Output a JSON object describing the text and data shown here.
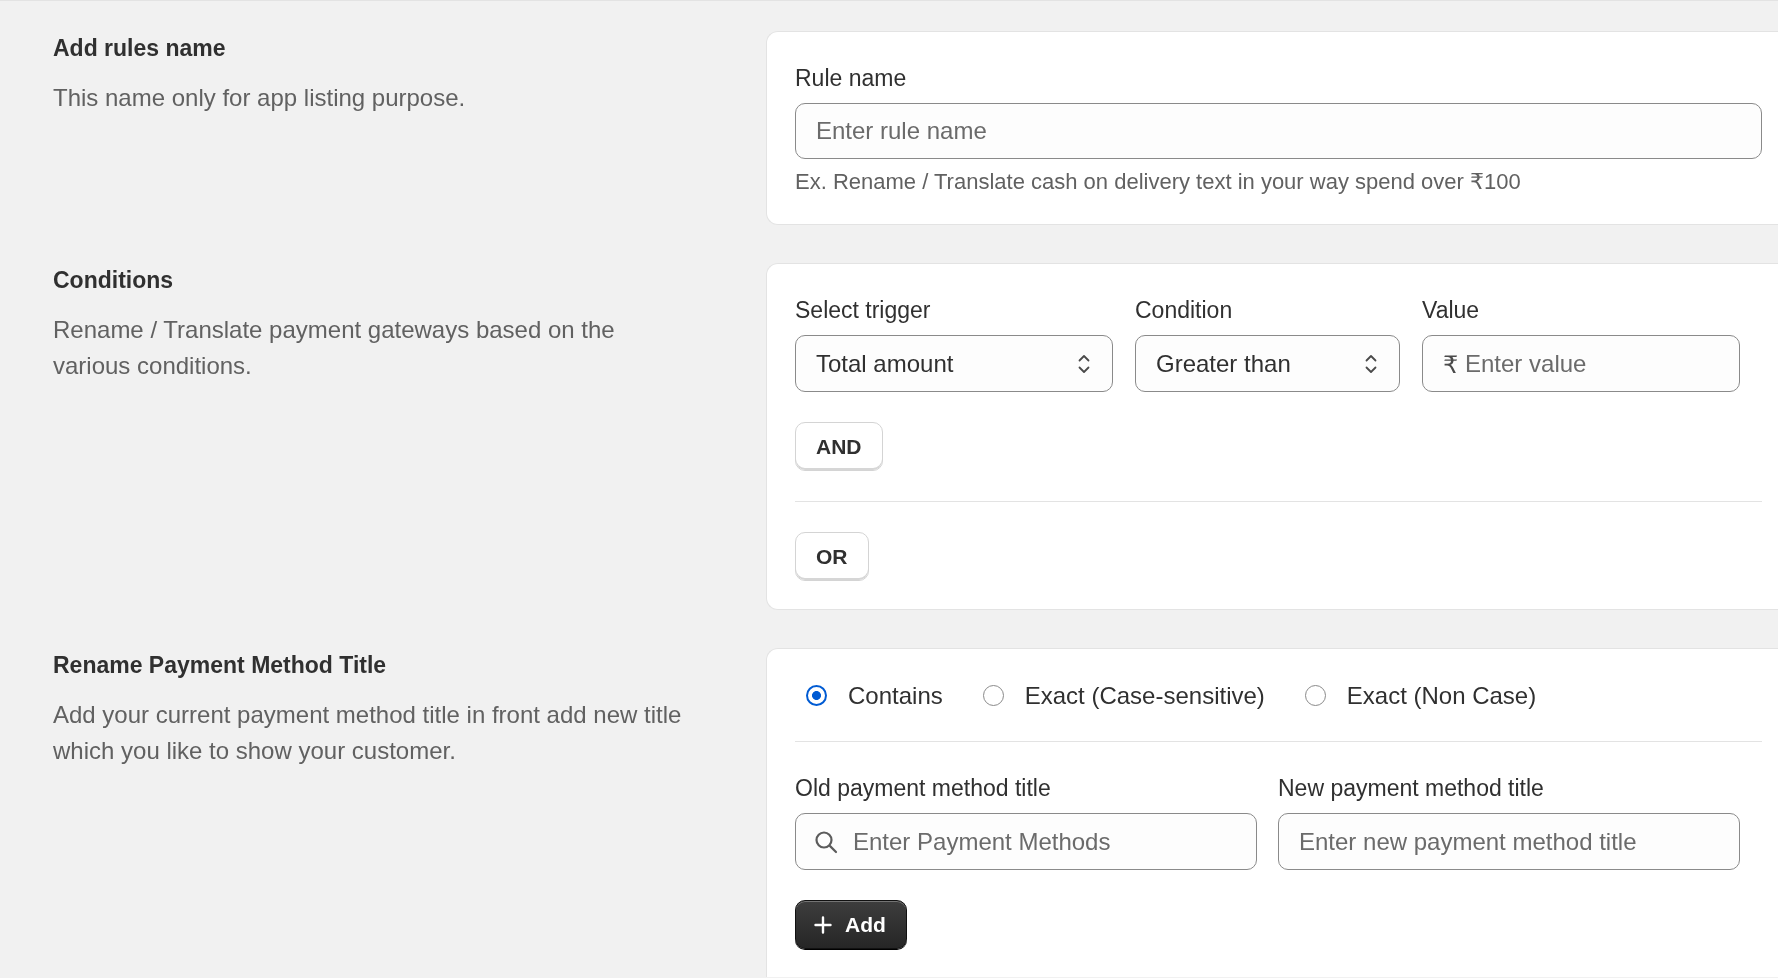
{
  "sections": [
    {
      "kind": "rule_name",
      "title": "Add rules name",
      "description": "This name only for app listing purpose.",
      "label": "Rule name",
      "placeholder": "Enter rule name",
      "help": "Ex. Rename / Translate cash on delivery text in your way spend over ₹100"
    },
    {
      "kind": "conditions",
      "title": "Conditions",
      "description": "Rename / Translate payment gateways based on the various conditions.",
      "fields": [
        {
          "kind": "select",
          "label": "Select trigger",
          "value": "Total amount"
        },
        {
          "kind": "select",
          "label": "Condition",
          "value": "Greater than"
        },
        {
          "kind": "input",
          "label": "Value",
          "prefix": "₹",
          "placeholder": "Enter value"
        }
      ],
      "and_button": "AND",
      "or_button": "OR"
    },
    {
      "kind": "rename",
      "title": "Rename Payment Method Title",
      "description": "Add your current payment method title in front add new title which you like to show your customer.",
      "match_options": [
        {
          "label": "Contains",
          "selected": true
        },
        {
          "label": "Exact (Case-sensitive)",
          "selected": false
        },
        {
          "label": "Exact (Non Case)",
          "selected": false
        }
      ],
      "fields": [
        {
          "kind": "search",
          "label": "Old payment method title",
          "placeholder": "Enter Payment Methods"
        },
        {
          "kind": "input",
          "label": "New payment method title",
          "placeholder": "Enter new payment method title"
        }
      ],
      "add_button": "Add"
    }
  ]
}
